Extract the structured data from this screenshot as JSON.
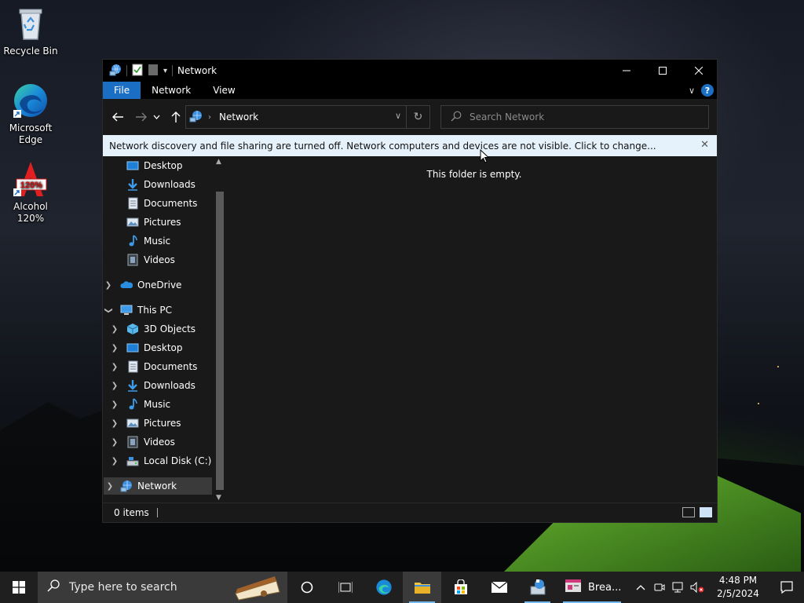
{
  "desktop": {
    "icons": [
      {
        "label": "Recycle Bin"
      },
      {
        "label": "Microsoft Edge"
      },
      {
        "label": "Alcohol 120%"
      }
    ]
  },
  "window": {
    "title": "Network",
    "ribbon_tabs": [
      "File",
      "Network",
      "View"
    ],
    "help_label": "?",
    "address_crumb": "Network",
    "search_placeholder": "Search Network",
    "infobar_text": "Network discovery and file sharing are turned off. Network computers and devices are not visible. Click to change...",
    "empty_text": "This folder is empty.",
    "status_items": "0 items"
  },
  "navpane": {
    "quick_access": [
      "Desktop",
      "Downloads",
      "Documents",
      "Pictures",
      "Music",
      "Videos"
    ],
    "onedrive": "OneDrive",
    "this_pc": "This PC",
    "this_pc_children": [
      "3D Objects",
      "Desktop",
      "Documents",
      "Downloads",
      "Music",
      "Pictures",
      "Videos",
      "Local Disk (C:)"
    ],
    "network": "Network"
  },
  "taskbar": {
    "search_placeholder": "Type here to search",
    "app_label": "Brea...",
    "time": "4:48 PM",
    "date": "2/5/2024"
  },
  "colors": {
    "accent": "#1a6fc4",
    "infobar_bg": "#e6f2fb",
    "window_bg": "#191919",
    "taskbar_bg": "#1f1f1f"
  }
}
